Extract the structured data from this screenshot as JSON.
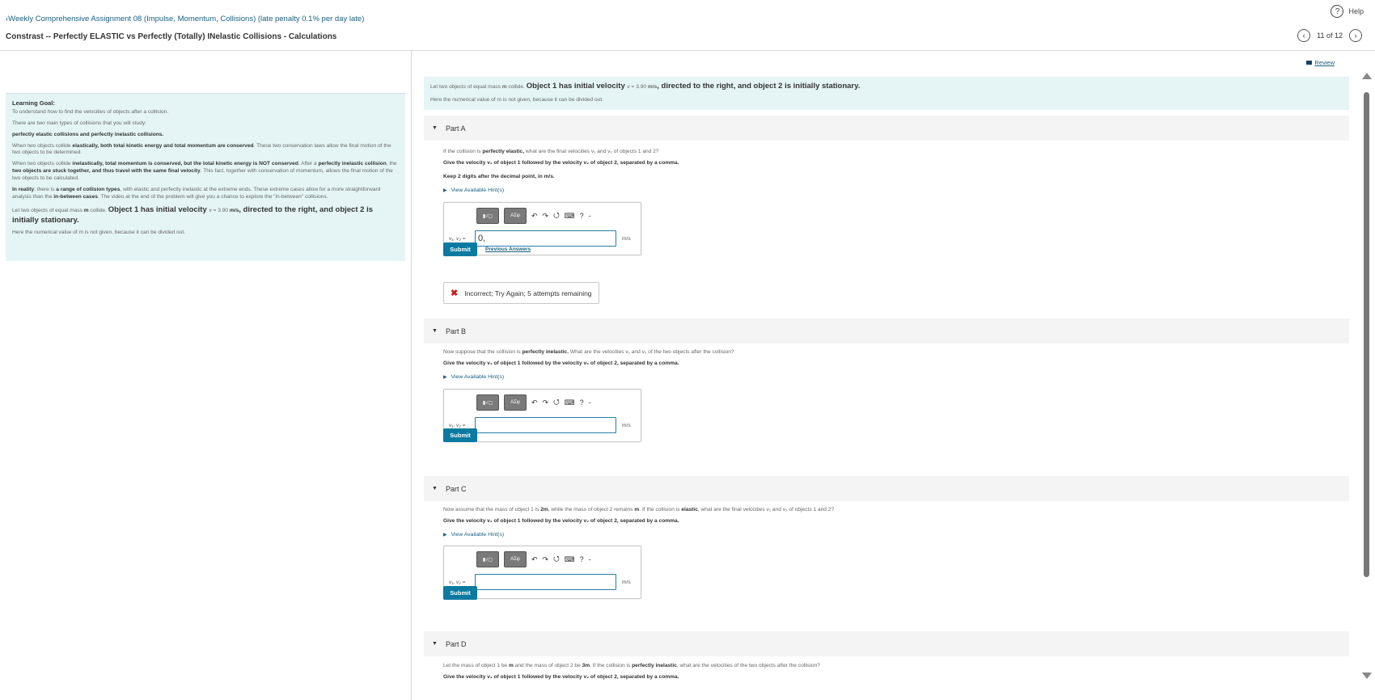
{
  "header": {
    "back_link": "Weekly Comprehensive Assignment 08 (Impulse, Momentum, Collisions) (late penalty 0.1% per day late)",
    "title": "Constrast -- Perfectly ELASTIC vs Perfectly (Totally) INelastic Collisions - Calculations",
    "help_label": "Help",
    "pager": "11 of 12"
  },
  "learning_goal": {
    "heading": "Learning Goal:",
    "line1": "To understand how to find the velocities of objects after a collision.",
    "line2": "There are two main types of collisions that you will study:",
    "line3": "perfectly elastic collisions and perfectly inelastic collisions.",
    "p1_a": "When two objects collide ",
    "p1_b": "elastically, both total kinetic energy and total momentum are conserved",
    "p1_c": ". These two conservation laws allow the final motion of the two objects to be determined.",
    "p2_a": "When two objects collide ",
    "p2_b": "inelastically, total momentum is conserved, but the total kinetic energy is NOT conserved",
    "p2_c": ". After a ",
    "p2_d": "perfectly inelastic collision",
    "p2_e": ", the ",
    "p2_f": "two objects are stuck together, and thus travel with the same final velocity",
    "p2_g": ". This fact, together with conservation of momentum, allows the final motion of the two objects to be calculated.",
    "p3_a": "In reality",
    "p3_b": ", there is ",
    "p3_c": "a range of collision types",
    "p3_d": ", with elastic and perfectly inelastic at the extreme ends. These extreme cases allow for a more straightforward analysis than the ",
    "p3_e": "in-between cases",
    "p3_f": ". The video at the end of the problem will give you a chance to explore the \"in-between\" collisions.",
    "p4_a": "Let two objects of equal mass ",
    "p4_m": "m",
    "p4_b": " collide. ",
    "p4_c": "Object 1 has initial velocity ",
    "p4_v": "v",
    "p4_eq": " = 3.90 ",
    "p4_unit": "m/s",
    "p4_d": ", directed to the right, and object 2 is initially stationary.",
    "p5": "Here the numerical value of m is not given, because it can be divided out."
  },
  "main": {
    "review": "Review",
    "intro_a": "Let two objects of equal mass ",
    "intro_m": "m",
    "intro_b": " collide. ",
    "intro_c": "Object 1 has initial velocity ",
    "intro_v": "v",
    "intro_eq": " = 3.90 ",
    "intro_unit": "m/s",
    "intro_d": ", directed to the right, and object 2 is initially stationary.",
    "intro_2": "Here the numerical value of m is not given, because it can be divided out.",
    "view_hints": "View Available Hint(s)",
    "give_velocity": "Give the velocity v₁ of object 1 followed by the velocity v₂ of object 2, separated by a comma.",
    "answer_label": "v₁, v₂ =",
    "unit": "m/s",
    "submit": "Submit",
    "toolbar": {
      "templates": "▮√▢",
      "symbols": "ΑΣφ",
      "undo": "↶",
      "redo": "↷",
      "reset": "⭯",
      "keyboard": "⌨",
      "help": "?",
      "more": "-"
    },
    "part_a": {
      "label": "Part A",
      "q_a": "If the collision is ",
      "q_b": "perfectly elastic,",
      "q_c": " what are the final velocities v₁ and v₂ of objects 1 and 2?",
      "keep": "Keep 2 digits after the decimal point, in m/s.",
      "value": "0,",
      "prev_answers": "Previous Answers",
      "feedback": "Incorrect; Try Again; 5 attempts remaining"
    },
    "part_b": {
      "label": "Part B",
      "q_a": "Now suppose that the collision is ",
      "q_b": "perfectly inelastic.",
      "q_c": " What are the velocities v₁ and v₂ of the two objects after the collision?",
      "value": ""
    },
    "part_c": {
      "label": "Part C",
      "q_a": "Now assume that the mass of object 1 is ",
      "q_b": "2m",
      "q_c": ", while the mass of object 2 remains ",
      "q_d": "m",
      "q_e": ". If the collision is ",
      "q_f": "elastic",
      "q_g": ", what are the final velocities v₁ and v₂ of objects 1 and 2?",
      "value": ""
    },
    "part_d": {
      "label": "Part D",
      "q_a": "Let the mass of object 1 be ",
      "q_b": "m",
      "q_c": " and the mass of object 2 be ",
      "q_d": "3m",
      "q_e": ". If the collision is ",
      "q_f": "perfectly inelastic",
      "q_g": ", what are the velocities of the two objects after the collision?"
    }
  }
}
